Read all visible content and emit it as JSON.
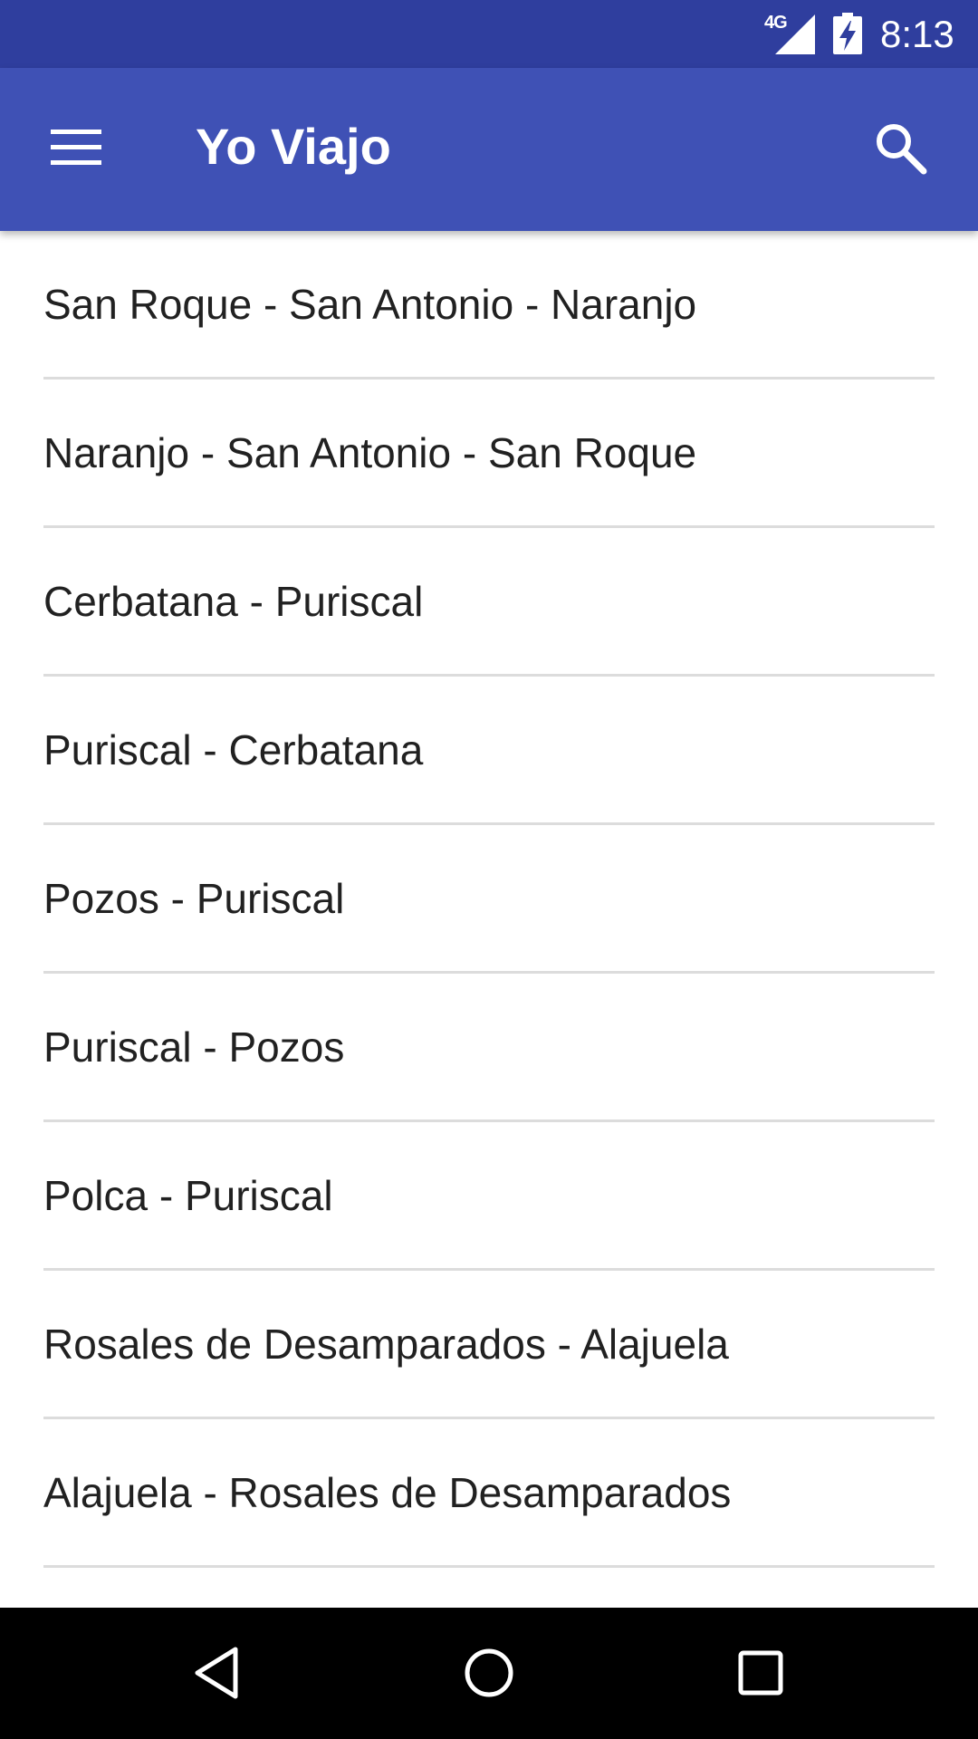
{
  "status_bar": {
    "network": "4G",
    "time": "8:13",
    "background_color": "#2f3e9e",
    "icons": [
      "signal-icon",
      "battery-charging-icon"
    ]
  },
  "app_bar": {
    "title": "Yo Viajo",
    "background_color": "#3f51b5",
    "menu_icon": "hamburger-menu-icon",
    "search_icon": "search-icon"
  },
  "routes": [
    {
      "label": "San Roque - San Antonio - Naranjo"
    },
    {
      "label": "Naranjo - San Antonio - San Roque"
    },
    {
      "label": "Cerbatana - Puriscal"
    },
    {
      "label": "Puriscal - Cerbatana"
    },
    {
      "label": "Pozos - Puriscal"
    },
    {
      "label": "Puriscal - Pozos"
    },
    {
      "label": "Polca - Puriscal"
    },
    {
      "label": "Rosales de Desamparados - Alajuela"
    },
    {
      "label": "Alajuela - Rosales de Desamparados"
    }
  ],
  "nav_bar": {
    "icons": [
      "back-icon",
      "home-icon",
      "recents-icon"
    ]
  }
}
